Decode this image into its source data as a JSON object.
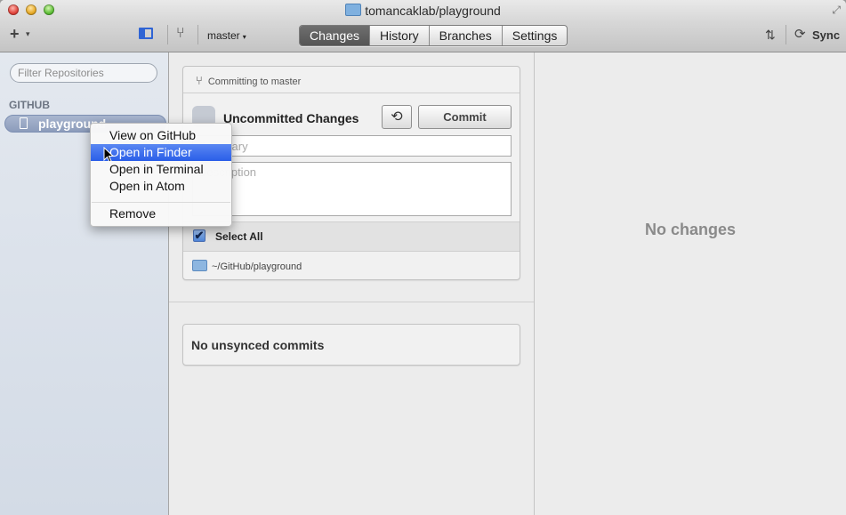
{
  "window": {
    "title": "tomancaklab/playground",
    "fullscreen_glyph": "⤢"
  },
  "toolbar": {
    "add_glyph": "+",
    "add_caret": "▾",
    "branch_glyph": "⑂",
    "branch": "master",
    "branch_caret": "▾",
    "tabs": [
      {
        "label": "Changes",
        "active": true
      },
      {
        "label": "History",
        "active": false
      },
      {
        "label": "Branches",
        "active": false
      },
      {
        "label": "Settings",
        "active": false
      }
    ],
    "pr_glyph": "⇅",
    "sync_glyph": "⟳",
    "sync_label": "Sync"
  },
  "sidebar": {
    "filter_placeholder": "Filter Repositories",
    "section_heading": "GITHUB",
    "items": [
      {
        "label": "playground",
        "selected": true
      }
    ]
  },
  "commit": {
    "branch_glyph": "⑂",
    "committing_label": "Committing to master",
    "heading": "Uncommitted Changes",
    "history_glyph": "⟲",
    "commit_button": "Commit",
    "summary_placeholder": "Summary",
    "description_placeholder": "Description",
    "check_glyph": "✔",
    "select_all": "Select All",
    "path": "~/GitHub/playground"
  },
  "unsynced": {
    "label": "No unsynced commits"
  },
  "detail": {
    "empty_label": "No changes"
  },
  "context_menu": {
    "items": [
      {
        "label": "View on GitHub"
      },
      {
        "label": "Open in Finder",
        "highlighted": true
      },
      {
        "label": "Open in Terminal"
      },
      {
        "label": "Open in Atom"
      },
      {
        "label": "Remove"
      }
    ]
  },
  "colors": {
    "accent": "#2a5ee8",
    "sidebar_selection": "#8c9cbb",
    "muted_text": "#8a8a8a"
  }
}
